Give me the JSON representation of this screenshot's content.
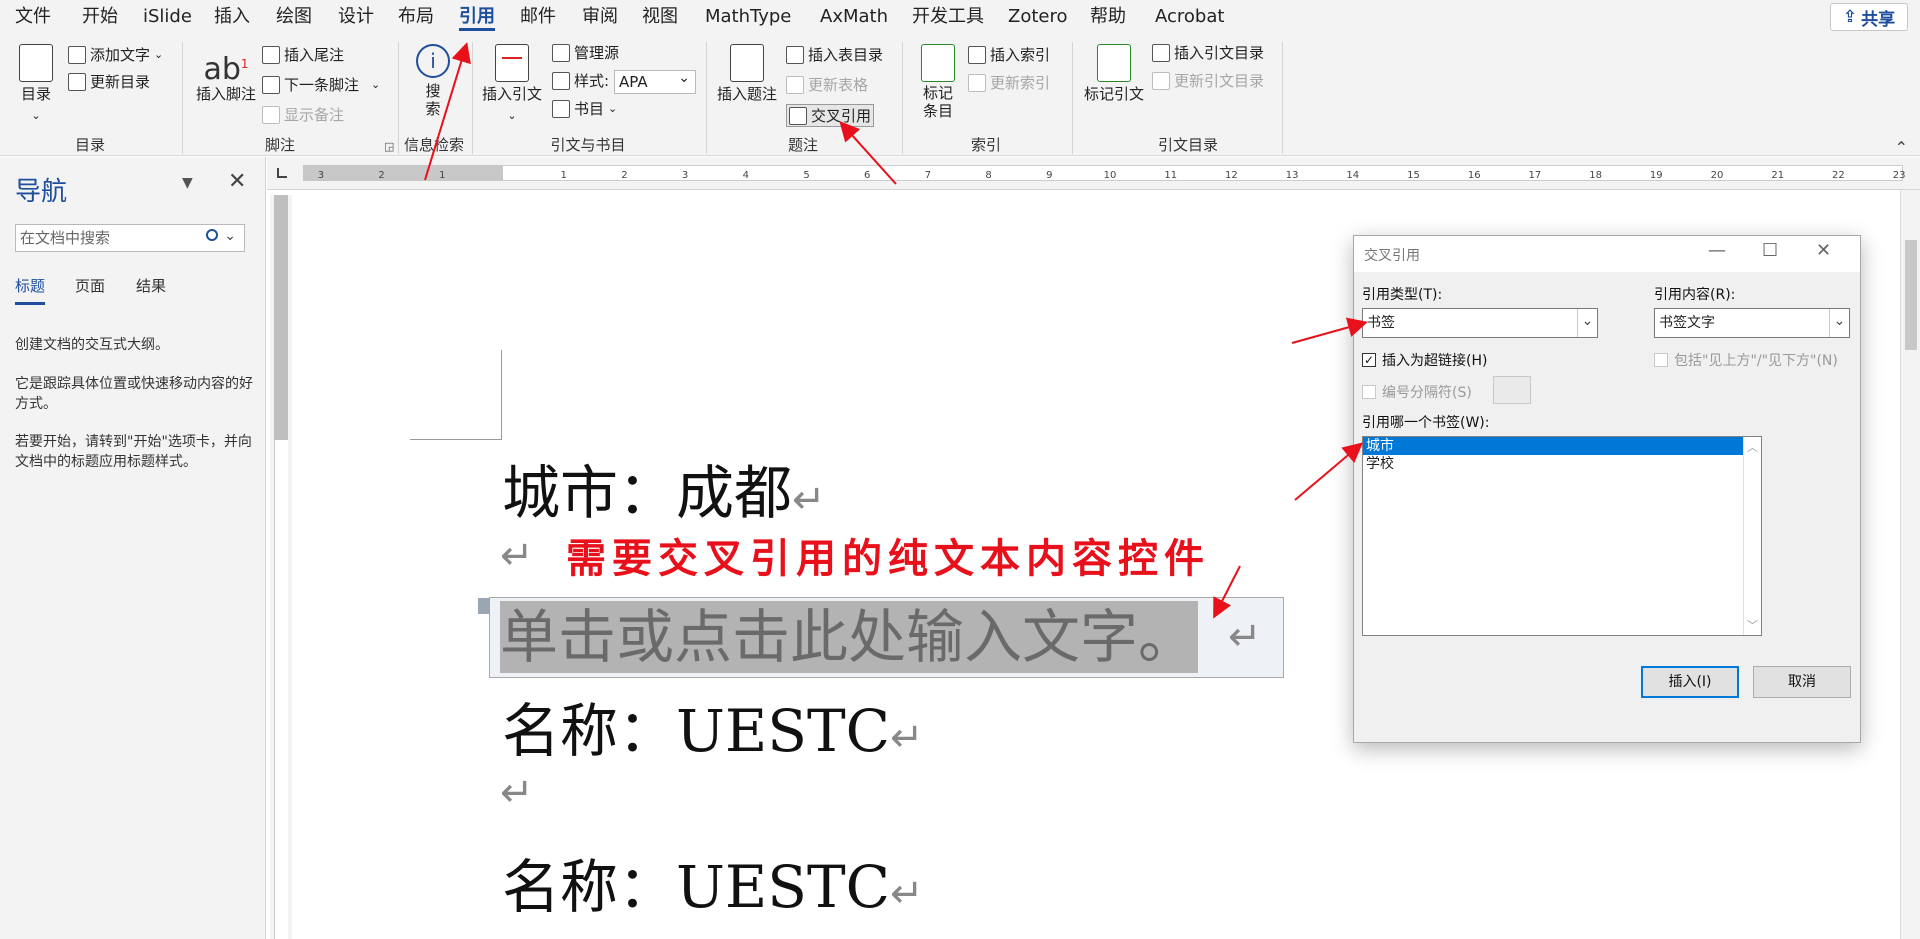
{
  "menu_tabs": [
    "文件",
    "开始",
    "iSlide",
    "插入",
    "绘图",
    "设计",
    "布局",
    "引用",
    "邮件",
    "审阅",
    "视图",
    "MathType",
    "AxMath",
    "开发工具",
    "Zotero",
    "帮助",
    "Acrobat"
  ],
  "active_tab": "引用",
  "share_label": "共享",
  "ribbon": {
    "toc": {
      "big": "目录",
      "add_text": "添加文字",
      "update_toc": "更新目录",
      "group": "目录"
    },
    "footnotes": {
      "big": "插入脚注",
      "big_icon_text": "ab",
      "insert_endnote": "插入尾注",
      "next_footnote": "下一条脚注",
      "show_notes": "显示备注",
      "group": "脚注"
    },
    "research": {
      "big": "搜索",
      "group": "信息检索"
    },
    "citations": {
      "big": "插入引文",
      "manage_sources": "管理源",
      "style_label": "样式:",
      "style_value": "APA",
      "bibliography": "书目",
      "group": "引文与书目"
    },
    "captions": {
      "big": "插入题注",
      "insert_tof": "插入表目录",
      "update_table": "更新表格",
      "cross_reference": "交叉引用",
      "group": "题注"
    },
    "index": {
      "big": "标记条目",
      "insert_index": "插入索引",
      "update_index": "更新索引",
      "group": "索引"
    },
    "toa": {
      "big": "标记引文",
      "insert_toa": "插入引文目录",
      "update_toa": "更新引文目录",
      "group": "引文目录"
    }
  },
  "nav": {
    "title": "导航",
    "search_placeholder": "在文档中搜索",
    "tabs": [
      "标题",
      "页面",
      "结果"
    ],
    "help1": "创建文档的交互式大纲。",
    "help2": "它是跟踪具体位置或快速移动内容的好方式。",
    "help3": "若要开始，请转到\"开始\"选项卡，并向文档中的标题应用标题样式。"
  },
  "ruler_ticks": [
    "3",
    "2",
    "1",
    "1",
    "2",
    "3",
    "4",
    "5",
    "6",
    "7",
    "8",
    "9",
    "10",
    "11",
    "12",
    "13",
    "14",
    "15",
    "16",
    "17",
    "18",
    "19",
    "20",
    "21",
    "22",
    "23"
  ],
  "doc": {
    "line1": "城市：成都",
    "note": "需要交叉引用的纯文本内容控件",
    "content_control": "单击或点击此处输入文字。",
    "line2": "名称：UESTC",
    "line3": "名称：UESTC",
    "para_mark": "↵"
  },
  "dialog": {
    "title": "交叉引用",
    "ref_type_label": "引用类型(T):",
    "ref_type_value": "书签",
    "ref_content_label": "引用内容(R):",
    "ref_content_value": "书签文字",
    "insert_hyperlink": "插入为超链接(H)",
    "include_above_below": "包括\"见上方\"/\"见下方\"(N)",
    "separate_numbers": "编号分隔符(S)",
    "for_which_label": "引用哪一个书签(W):",
    "bookmarks": [
      "城市",
      "学校"
    ],
    "insert_btn": "插入(I)",
    "cancel_btn": "取消"
  },
  "colors": {
    "accent": "#1e4e9c",
    "annotation_red": "#e8101a",
    "selection": "#0078d7"
  }
}
